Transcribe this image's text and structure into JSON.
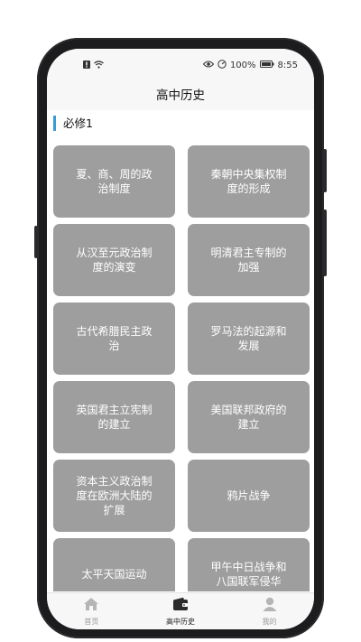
{
  "status_bar": {
    "battery_percent": "100%",
    "time": "8:55"
  },
  "header": {
    "title": "高中历史"
  },
  "section": {
    "label": "必修1"
  },
  "cards": [
    "夏、商、周的政治制度",
    "秦朝中央集权制度的形成",
    "从汉至元政治制度的演变",
    "明清君主专制的加强",
    "古代希腊民主政治",
    "罗马法的起源和发展",
    "英国君主立宪制的建立",
    "美国联邦政府的建立",
    "资本主义政治制度在欧洲大陆的扩展",
    "鸦片战争",
    "太平天国运动",
    "甲午中日战争和八国联军侵华"
  ],
  "tabs": [
    {
      "label": "首页",
      "icon": "home-icon"
    },
    {
      "label": "高中历史",
      "icon": "wallet-icon",
      "active": true
    },
    {
      "label": "我的",
      "icon": "person-icon"
    }
  ],
  "colors": {
    "accent": "#3a9bd6",
    "card": "#9e9e9e",
    "bar": "#f7f7f7"
  }
}
